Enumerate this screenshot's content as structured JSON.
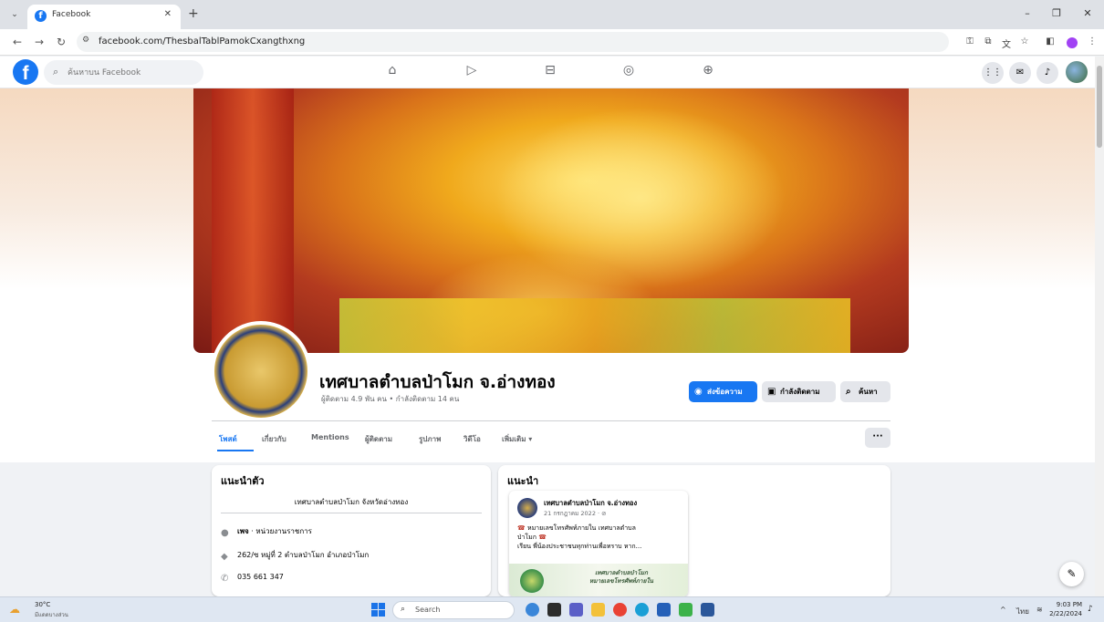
{
  "browser": {
    "tab_title": "Facebook",
    "url": "facebook.com/ThesbalTablPamokCxangthxng"
  },
  "fb_header": {
    "logo": "f",
    "search_placeholder": "ค้นหาบน Facebook",
    "nav_icons": [
      "home-icon",
      "video-icon",
      "marketplace-icon",
      "groups-icon",
      "gaming-icon"
    ],
    "right_icons": [
      "menu-grid-icon",
      "messenger-icon",
      "notifications-icon",
      "account-avatar"
    ]
  },
  "page": {
    "name": "เทศบาลตำบลป่าโมก จ.อ่างทอง",
    "meta": "ผู้ติดตาม 4.9 พัน คน • กำลังติดตาม 14 คน",
    "buttons": {
      "message": "ส่งข้อความ",
      "following": "กำลังติดตาม",
      "search": "ค้นหา"
    },
    "tabs": [
      "โพสต์",
      "เกี่ยวกับ",
      "Mentions",
      "ผู้ติดตาม",
      "รูปภาพ",
      "วิดีโอ",
      "เพิ่มเติม ▾"
    ],
    "active_tab": "โพสต์",
    "more_button": "···"
  },
  "intro": {
    "title": "แนะนำตัว",
    "bio": "เทศบาลตำบลป่าโมก จังหวัดอ่างทอง",
    "category_label": "เพจ",
    "category_value": " · หน่วยงานราชการ",
    "address": "262/ซ หมู่ที่ 2 ตำบลป่าโมก อำเภอป่าโมก",
    "phone": "035 661 347"
  },
  "featured": {
    "title": "แนะนำ",
    "post": {
      "author": "เทศบาลตำบลป่าโมก จ.อ่างทอง",
      "date": "21 กรกฎาคม 2022 · ⊘",
      "line1": "หมายเลขโทรศัพท์ภายใน เทศบาลตำบล",
      "line2": "ป่าโมก",
      "line3": "เรียน พี่น้องประชาชนทุกท่านเพื่อทราบ หาก...",
      "image_text1": "เทศบาลตำบลป่าโมก",
      "image_text2": "หมายเลขโทรศัพท์ภายใน"
    }
  },
  "taskbar": {
    "temp": "30°C",
    "weather": "มีแดดบางส่วน",
    "search": "Search",
    "lang": "ไทย",
    "time": "9:03 PM",
    "date": "2/22/2024"
  },
  "colors": {
    "fb_blue": "#1877f2",
    "page_bg": "#f0f2f5"
  }
}
